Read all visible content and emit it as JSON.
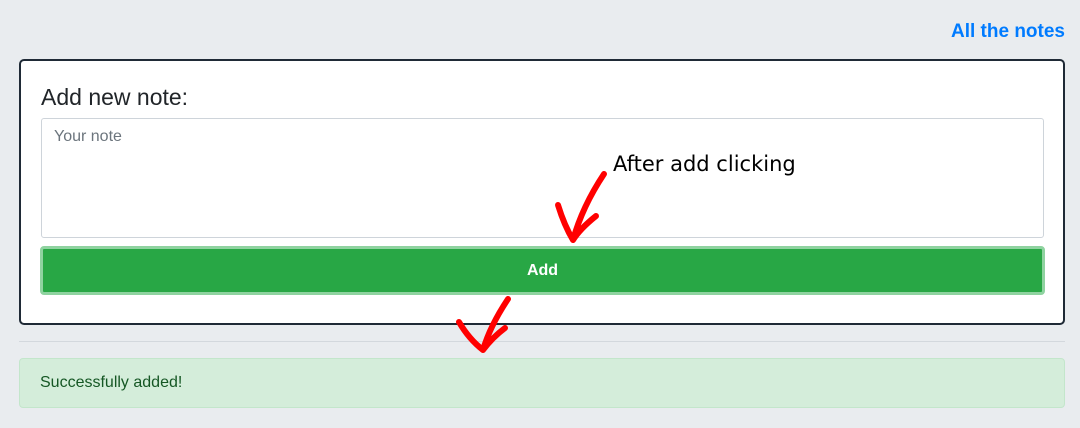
{
  "nav": {
    "all_notes_label": "All the notes"
  },
  "form": {
    "title": "Add new note:",
    "note_placeholder": "Your note",
    "note_value": "",
    "add_label": "Add"
  },
  "alert": {
    "message": "Successfully added!"
  },
  "annotation": {
    "text": "After add clicking",
    "arrow_color": "#ff0000"
  },
  "colors": {
    "page_background": "#e9ecef",
    "link": "#007bff",
    "button": "#28a745",
    "alert_background": "#d4edda",
    "alert_text": "#155724"
  }
}
